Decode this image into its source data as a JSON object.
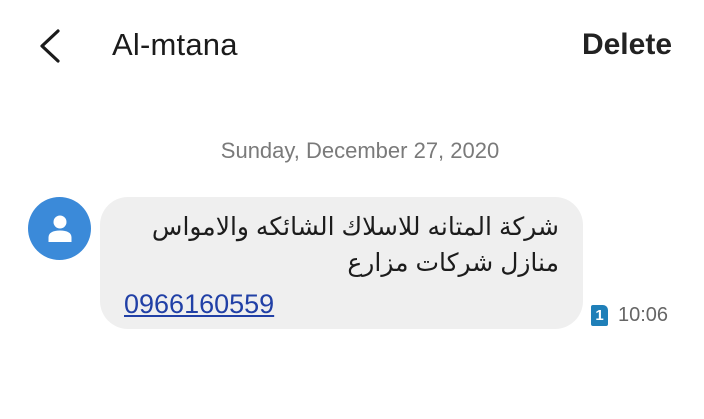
{
  "header": {
    "title": "Al-mtana",
    "delete_label": "Delete"
  },
  "thread": {
    "date_separator": "Sunday, December 27, 2020",
    "message": {
      "lines": [
        "شركة المتانه للاسلاك الشائكه والامواس",
        "منازل شركات مزارع"
      ],
      "phone_link": "0966160559",
      "sim_slot": "1",
      "time": "10:06"
    }
  },
  "icons": {
    "back": "back-arrow-icon",
    "avatar": "person-icon"
  },
  "colors": {
    "avatar_bg": "#3b8ad9",
    "bubble_bg": "#efefef",
    "link": "#2140a6",
    "sim_badge": "#1f7fb8"
  }
}
